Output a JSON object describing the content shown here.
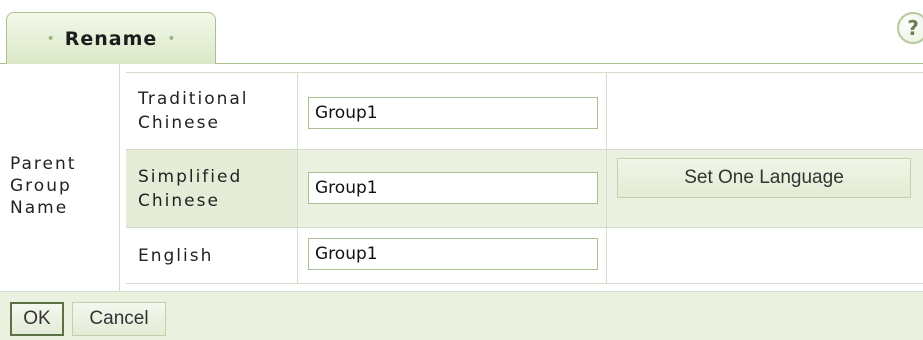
{
  "tab": {
    "label": "Rename",
    "left_ornament": "•",
    "right_ornament": "•"
  },
  "help": {
    "label": "?",
    "icon": "help-icon"
  },
  "form": {
    "group_label": "Parent Group Name",
    "rows": [
      {
        "label": "Traditional Chinese",
        "value": "Group1"
      },
      {
        "label": "Simplified Chinese",
        "value": "Group1"
      },
      {
        "label": "English",
        "value": "Group1"
      }
    ],
    "set_language_label": "Set One Language"
  },
  "footer": {
    "ok_label": "OK",
    "cancel_label": "Cancel"
  },
  "colors": {
    "accent_border": "#a9c08f",
    "row_highlight": "#eaf1e0",
    "footer_bg": "#eaf1df"
  }
}
